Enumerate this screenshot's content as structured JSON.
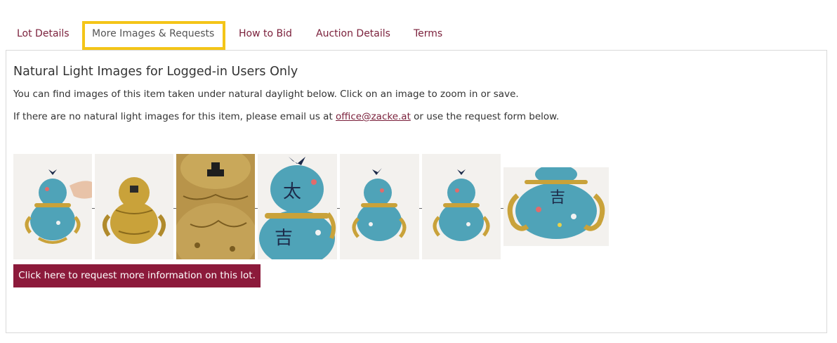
{
  "tabs": [
    {
      "label": "Lot Details",
      "active": false
    },
    {
      "label": "More Images & Requests",
      "active": true
    },
    {
      "label": "How to Bid",
      "active": false
    },
    {
      "label": "Auction Details",
      "active": false
    },
    {
      "label": "Terms",
      "active": false
    }
  ],
  "content": {
    "heading": "Natural Light Images for Logged-in Users Only",
    "paragraph1": "You can find images of this item taken under natural daylight below. Click on an image to zoom in or save.",
    "paragraph2_before": "If there are no natural light images for this item, please email us at ",
    "email": "office@zacke.at",
    "paragraph2_after": " or use the request form below."
  },
  "images": [
    {
      "name": "vase-front-with-hand"
    },
    {
      "name": "vase-back-gilt"
    },
    {
      "name": "vase-back-detail"
    },
    {
      "name": "vase-closeup-characters"
    },
    {
      "name": "vase-angle-left"
    },
    {
      "name": "vase-angle-right"
    },
    {
      "name": "vase-wide-detail"
    }
  ],
  "request_button": "Click here to request more information on this lot.",
  "colors": {
    "accent": "#7a1f3a",
    "button": "#8c1a3b",
    "highlight": "#f4c518",
    "enamel": "#4fa3b8",
    "gilt": "#c9a23a"
  }
}
